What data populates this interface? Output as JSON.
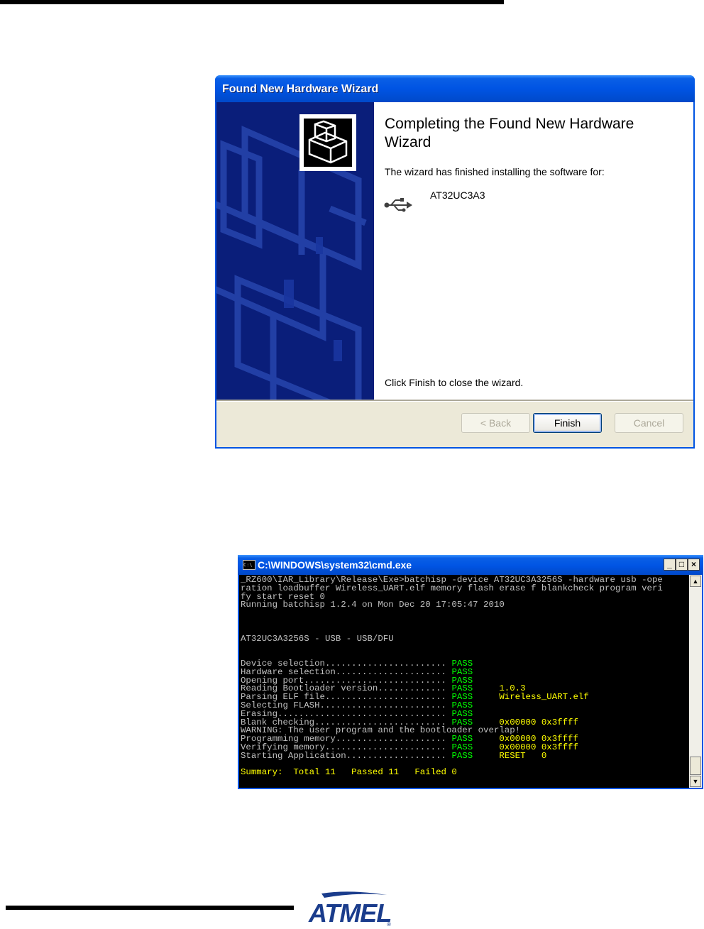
{
  "wizard": {
    "title": "Found New Hardware Wizard",
    "heading": "Completing the Found New Hardware Wizard",
    "subtext": "The wizard has finished installing the software for:",
    "device_icon": "usb-icon",
    "device_name": "AT32UC3A3",
    "finish_hint": "Click Finish to close the wizard.",
    "buttons": {
      "back": "< Back",
      "finish": "Finish",
      "cancel": "Cancel"
    }
  },
  "console": {
    "title": "C:\\WINDOWS\\system32\\cmd.exe",
    "controls": {
      "minimize": "_",
      "maximize": "□",
      "close": "×"
    },
    "lines": [
      {
        "text": "_RZ600\\IAR_Library\\Release\\Exe>batchisp -device AT32UC3A3256S -hardware usb -ope"
      },
      {
        "text": "ration loadbuffer Wireless_UART.elf memory flash erase f blankcheck program veri"
      },
      {
        "text": "fy start reset 0"
      },
      {
        "text": "Running batchisp 1.2.4 on Mon Dec 20 17:05:47 2010"
      },
      {
        "text": ""
      },
      {
        "text": ""
      },
      {
        "text": ""
      },
      {
        "text": "AT32UC3A3256S - USB - USB/DFU"
      },
      {
        "text": ""
      },
      {
        "text": ""
      },
      {
        "text": "Device selection....................... ",
        "status": "PASS"
      },
      {
        "text": "Hardware selection..................... ",
        "status": "PASS"
      },
      {
        "text": "Opening port........................... ",
        "status": "PASS"
      },
      {
        "text": "Reading Bootloader version............. ",
        "status": "PASS",
        "detail": "1.0.3"
      },
      {
        "text": "Parsing ELF file....................... ",
        "status": "PASS",
        "detail": "Wireless_UART.elf"
      },
      {
        "text": "Selecting FLASH........................ ",
        "status": "PASS"
      },
      {
        "text": "Erasing................................ ",
        "status": "PASS"
      },
      {
        "text": "Blank checking......................... ",
        "status": "PASS",
        "detail": "0x00000 0x3ffff"
      },
      {
        "text": "WARNING: The user program and the bootloader overlap!"
      },
      {
        "text": "Programming memory..................... ",
        "status": "PASS",
        "detail": "0x00000 0x3ffff"
      },
      {
        "text": "Verifying memory....................... ",
        "status": "PASS",
        "detail": "0x00000 0x3ffff"
      },
      {
        "text": "Starting Application................... ",
        "status": "PASS",
        "detail": "RESET   0"
      },
      {
        "text": ""
      },
      {
        "summary": "Summary:  Total 11   Passed 11   Failed 0"
      }
    ]
  },
  "logo": {
    "text": "ATMEL",
    "registered": "®"
  },
  "colors": {
    "xp_blue": "#0054e3",
    "pass_green": "#00ff00",
    "summary_yellow": "#ffff00"
  }
}
